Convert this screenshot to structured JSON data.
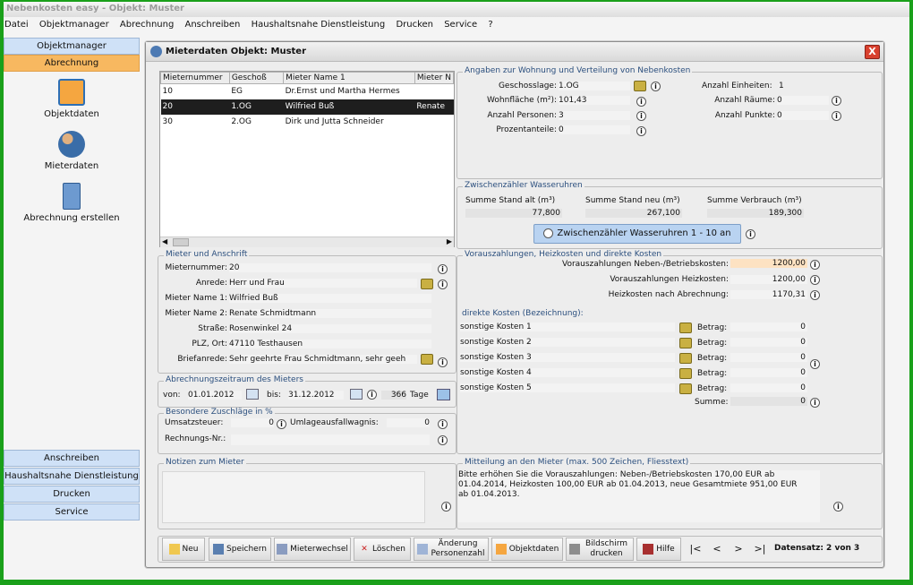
{
  "window": {
    "title": "Nebenkosten easy  -  Objekt: Muster"
  },
  "menu": [
    "Datei",
    "Objektmanager",
    "Abrechnung",
    "Anschreiben",
    "Haushaltsnahe Dienstleistung",
    "Drucken",
    "Service",
    "?"
  ],
  "sidebar": {
    "top": [
      {
        "label": "Objektmanager"
      },
      {
        "label": "Abrechnung"
      }
    ],
    "items": [
      {
        "label": "Objektdaten"
      },
      {
        "label": "Mieterdaten"
      },
      {
        "label": "Abrechnung erstellen"
      }
    ],
    "bottom": [
      "Anschreiben",
      "Haushaltsnahe Dienstleistung",
      "Drucken",
      "Service"
    ]
  },
  "dialog": {
    "title": "Mieterdaten  Objekt: Muster",
    "close": "X"
  },
  "table": {
    "columns": [
      "Mieternummer",
      "Geschoß",
      "Mieter Name 1",
      "Mieter N"
    ],
    "rows": [
      [
        "10",
        "EG",
        "Dr.Ernst und Martha Hermes",
        ""
      ],
      [
        "20",
        "1.OG",
        "Wilfried Buß",
        "Renate"
      ],
      [
        "30",
        "2.OG",
        "Dirk und Jutta Schneider",
        ""
      ]
    ],
    "selected": 1
  },
  "wohnung": {
    "legend": "Angaben zur Wohnung und Verteilung von Nebenkosten",
    "geschoss_label": "Geschosslage:",
    "geschoss": "1.OG",
    "flaeche_label": "Wohnfläche (m²):",
    "flaeche": "101,43",
    "personen_label": "Anzahl Personen:",
    "personen": "3",
    "prozent_label": "Prozentanteile:",
    "prozent": "0",
    "einheiten_label": "Anzahl Einheiten:",
    "einheiten": "1",
    "raeume_label": "Anzahl Räume:",
    "raeume": "0",
    "punkte_label": "Anzahl Punkte:",
    "punkte": "0"
  },
  "wasser": {
    "legend": "Zwischenzähler Wasseruhren",
    "alt_label": "Summe Stand alt (m³)",
    "alt": "77,800",
    "neu_label": "Summe Stand neu (m³)",
    "neu": "267,100",
    "verbrauch_label": "Summe Verbrauch (m³)",
    "verbrauch": "189,300",
    "button": "Zwischenzähler Wasseruhren 1 - 10 an"
  },
  "mieter": {
    "legend": "Mieter und Anschrift",
    "nr_label": "Mieternummer:",
    "nr": "20",
    "anrede_label": "Anrede:",
    "anrede": "Herr und Frau",
    "name1_label": "Mieter Name 1:",
    "name1": "Wilfried Buß",
    "name2_label": "Mieter Name 2:",
    "name2": "Renate Schmidtmann",
    "strasse_label": "Straße:",
    "strasse": "Rosenwinkel 24",
    "plz_label": "PLZ, Ort:",
    "plz": "47110 Testhausen",
    "brief_label": "Briefanrede:",
    "brief": "Sehr geehrte Frau Schmidtmann, sehr geeh"
  },
  "zeitraum": {
    "legend": "Abrechnungszeitraum des Mieters",
    "von_label": "von:",
    "von": "01.01.2012",
    "bis_label": "bis:",
    "bis": "31.12.2012",
    "tage": "366",
    "tage_label": "Tage"
  },
  "zuschlaege": {
    "legend": "Besondere Zuschläge in %",
    "ust_label": "Umsatzsteuer:",
    "ust": "0",
    "umlage_label": "Umlageausfallwagnis:",
    "umlage": "0",
    "rechnr_label": "Rechnungs-Nr.:",
    "rechnr": ""
  },
  "notizen": {
    "legend": "Notizen zum Mieter",
    "text": ""
  },
  "voraus": {
    "legend": "Vorauszahlungen, Heizkosten und direkte Kosten",
    "neben_label": "Vorauszahlungen Neben-/Betriebskosten:",
    "neben": "1200,00",
    "heiz_label": "Vorauszahlungen Heizkosten:",
    "heiz": "1200,00",
    "heiznach_label": "Heizkosten nach Abrechnung:",
    "heiznach": "1170,31",
    "direkt_label": "direkte Kosten (Bezeichnung):",
    "kosten": [
      {
        "name": "sonstige Kosten 1",
        "betrag_label": "Betrag:",
        "betrag": "0"
      },
      {
        "name": "sonstige Kosten 2",
        "betrag_label": "Betrag:",
        "betrag": "0"
      },
      {
        "name": "sonstige Kosten 3",
        "betrag_label": "Betrag:",
        "betrag": "0"
      },
      {
        "name": "sonstige Kosten 4",
        "betrag_label": "Betrag:",
        "betrag": "0"
      },
      {
        "name": "sonstige Kosten 5",
        "betrag_label": "Betrag:",
        "betrag": "0"
      }
    ],
    "summe_label": "Summe:",
    "summe": "0"
  },
  "mitteilung": {
    "legend": "Mitteilung an den Mieter (max. 500 Zeichen, Fliesstext)",
    "lines": [
      "Bitte erhöhen Sie die Vorauszahlungen: Neben-/Betriebskosten 170,00 EUR ab",
      "01.04.2014, Heizkosten 100,00 EUR ab 01.04.2013, neue Gesamtmiete 951,00 EUR",
      "ab 01.04.2013."
    ]
  },
  "toolbar": {
    "neu": "Neu",
    "speichern": "Speichern",
    "mieterwechsel": "Mieterwechsel",
    "loeschen": "Löschen",
    "aenderung1": "Änderung",
    "aenderung2": "Personenzahl",
    "objektdaten": "Objektdaten",
    "bild1": "Bildschirm",
    "bild2": "drucken",
    "hilfe": "Hilfe",
    "first": "|<",
    "prev": "<",
    "next": ">",
    "last": ">|",
    "datensatz": "Datensatz: 2 von 3"
  },
  "colors": {
    "accent_blue": "#cfe1f7",
    "accent_orange": "#f7b860",
    "selected_row": "#1e1e1e",
    "highlight_field": "#fde2c2"
  }
}
